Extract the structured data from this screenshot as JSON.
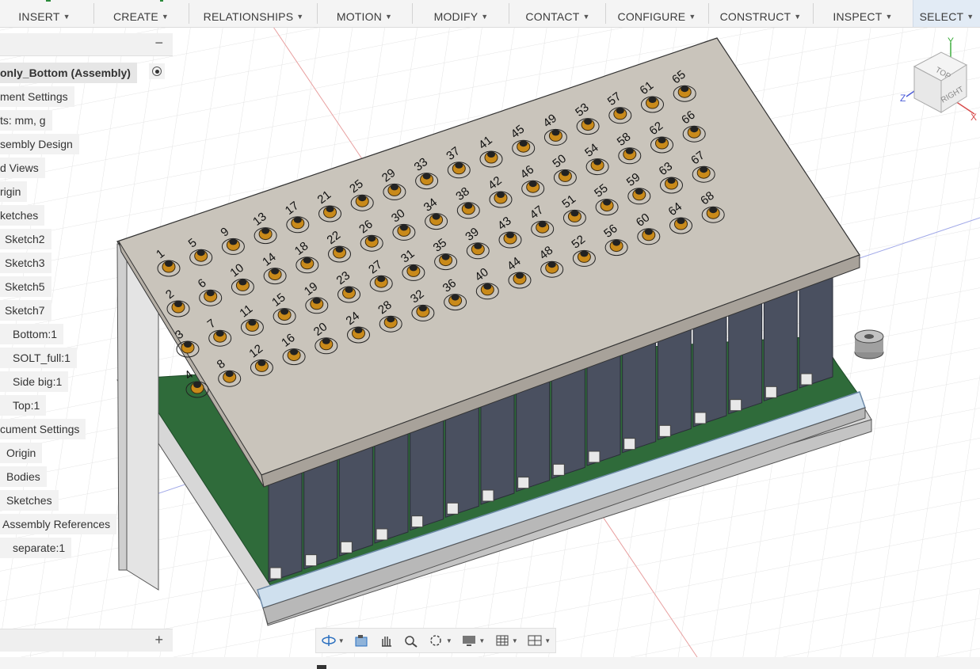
{
  "toolbar": {
    "menus": [
      {
        "label": "INSERT"
      },
      {
        "label": "CREATE"
      },
      {
        "label": "RELATIONSHIPS"
      },
      {
        "label": "MOTION"
      },
      {
        "label": "MODIFY"
      },
      {
        "label": "CONTACT"
      },
      {
        "label": "CONFIGURE"
      },
      {
        "label": "CONSTRUCT"
      },
      {
        "label": "INSPECT"
      },
      {
        "label": "SELECT"
      }
    ]
  },
  "browser": {
    "collapse_icon": "minus-icon",
    "nodes": [
      {
        "label": "only_Bottom (Assembly)"
      },
      {
        "label": "ment Settings"
      },
      {
        "label": "ts: mm, g"
      },
      {
        "label": "sembly Design"
      },
      {
        "label": "d Views"
      },
      {
        "label": "rigin"
      },
      {
        "label": "ketches"
      },
      {
        "label": "Sketch2"
      },
      {
        "label": "Sketch3"
      },
      {
        "label": "Sketch5"
      },
      {
        "label": "Sketch7"
      },
      {
        "label": "Bottom:1"
      },
      {
        "label": "SOLT_full:1"
      },
      {
        "label": "Side big:1"
      },
      {
        "label": "Top:1"
      },
      {
        "label": "cument Settings"
      },
      {
        "label": "Origin"
      },
      {
        "label": "Bodies"
      },
      {
        "label": "Sketches"
      },
      {
        "label": "Assembly References"
      },
      {
        "label": "separate:1"
      }
    ]
  },
  "viewcube": {
    "top": "TOP",
    "right": "RIGHT",
    "axis_x": "X",
    "axis_y": "Y",
    "axis_z": "Z"
  },
  "model": {
    "port_labels": [
      "1",
      "2",
      "3",
      "4",
      "5",
      "6",
      "7",
      "8",
      "9",
      "10",
      "11",
      "12",
      "13",
      "14",
      "15",
      "16",
      "17",
      "18",
      "19",
      "20",
      "21",
      "22",
      "23",
      "24",
      "25",
      "26",
      "27",
      "28",
      "29",
      "30",
      "31",
      "32",
      "33",
      "34",
      "35",
      "36",
      "37",
      "38",
      "39",
      "40",
      "41",
      "42",
      "43",
      "44",
      "45",
      "46",
      "47",
      "48",
      "49",
      "50",
      "51",
      "52",
      "53",
      "54",
      "55",
      "56",
      "57",
      "58",
      "59",
      "60",
      "61",
      "62",
      "63",
      "64",
      "65",
      "66",
      "67",
      "68"
    ]
  },
  "navbar": {
    "tools": [
      "orbit-icon",
      "look-at-icon",
      "pan-icon",
      "zoom-icon",
      "fit-icon",
      "display-settings-icon",
      "grid-icon",
      "viewports-icon"
    ]
  },
  "colors": {
    "toolbar_bg": "#f4f4f4",
    "panel_bg": "#f2f2f2",
    "top_plate": "#c9c4bb",
    "pcb": "#2f6b3a",
    "cards": "#4a5060",
    "connector": "#c98a1a"
  }
}
